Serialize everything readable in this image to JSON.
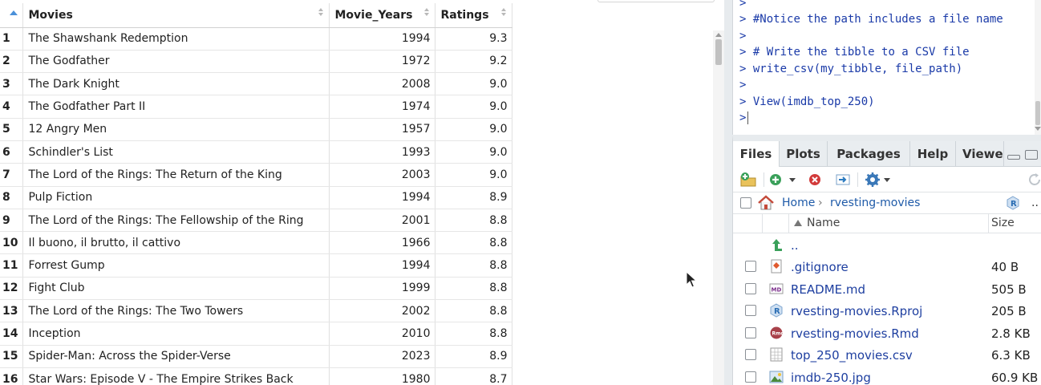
{
  "viewer": {
    "columns": [
      {
        "label": "Movies",
        "sort": "active-asc"
      },
      {
        "label": "Movie_Years",
        "sort": "none"
      },
      {
        "label": "Ratings",
        "sort": "none"
      }
    ],
    "rows": [
      {
        "n": "1",
        "movie": "The Shawshank Redemption",
        "year": "1994",
        "rating": "9.3"
      },
      {
        "n": "2",
        "movie": "The Godfather",
        "year": "1972",
        "rating": "9.2"
      },
      {
        "n": "3",
        "movie": "The Dark Knight",
        "year": "2008",
        "rating": "9.0"
      },
      {
        "n": "4",
        "movie": "The Godfather Part II",
        "year": "1974",
        "rating": "9.0"
      },
      {
        "n": "5",
        "movie": "12 Angry Men",
        "year": "1957",
        "rating": "9.0"
      },
      {
        "n": "6",
        "movie": "Schindler's List",
        "year": "1993",
        "rating": "9.0"
      },
      {
        "n": "7",
        "movie": "The Lord of the Rings: The Return of the King",
        "year": "2003",
        "rating": "9.0"
      },
      {
        "n": "8",
        "movie": "Pulp Fiction",
        "year": "1994",
        "rating": "8.9"
      },
      {
        "n": "9",
        "movie": "The Lord of the Rings: The Fellowship of the Ring",
        "year": "2001",
        "rating": "8.8"
      },
      {
        "n": "10",
        "movie": "Il buono, il brutto, il cattivo",
        "year": "1966",
        "rating": "8.8"
      },
      {
        "n": "11",
        "movie": "Forrest Gump",
        "year": "1994",
        "rating": "8.8"
      },
      {
        "n": "12",
        "movie": "Fight Club",
        "year": "1999",
        "rating": "8.8"
      },
      {
        "n": "13",
        "movie": "The Lord of the Rings: The Two Towers",
        "year": "2002",
        "rating": "8.8"
      },
      {
        "n": "14",
        "movie": "Inception",
        "year": "2010",
        "rating": "8.8"
      },
      {
        "n": "15",
        "movie": "Spider-Man: Across the Spider-Verse",
        "year": "2023",
        "rating": "8.9"
      },
      {
        "n": "16",
        "movie": "Star Wars: Episode V - The Empire Strikes Back",
        "year": "1980",
        "rating": "8.7"
      }
    ]
  },
  "console": {
    "lines": [
      {
        "prompt": ">",
        "text": " #Notice the path includes a file name"
      },
      {
        "prompt": ">",
        "text": ""
      },
      {
        "prompt": ">",
        "text": " # Write the tibble to a CSV file"
      },
      {
        "prompt": ">",
        "text": " write_csv(my_tibble, file_path)"
      },
      {
        "prompt": ">",
        "text": ""
      },
      {
        "prompt": ">",
        "text": " View(imdb_top_250)"
      },
      {
        "prompt": ">",
        "text": ""
      }
    ]
  },
  "files_pane": {
    "tabs": [
      "Files",
      "Plots",
      "Packages",
      "Help",
      "Viewer"
    ],
    "active_tab": "Files",
    "breadcrumb": {
      "home": "Home",
      "folder": "rvesting-movies",
      "more": ".."
    },
    "header": {
      "name": "Name",
      "size": "Size"
    },
    "parent_link": "..",
    "files": [
      {
        "name": ".gitignore",
        "size": "40 B",
        "icon": "git-file-icon"
      },
      {
        "name": "README.md",
        "size": "505 B",
        "icon": "markdown-file-icon"
      },
      {
        "name": "rvesting-movies.Rproj",
        "size": "205 B",
        "icon": "rproj-file-icon"
      },
      {
        "name": "rvesting-movies.Rmd",
        "size": "2.8 KB",
        "icon": "rmd-file-icon"
      },
      {
        "name": "top_250_movies.csv",
        "size": "6.3 KB",
        "icon": "csv-file-icon"
      },
      {
        "name": "imdb-250.jpg",
        "size": "60.9 KB",
        "icon": "image-file-icon"
      }
    ]
  },
  "colors": {
    "link": "#1e3fa0",
    "console_text": "#1a3aa8",
    "sort_active": "#4a90d9",
    "pane_bg": "#e9edf0"
  }
}
